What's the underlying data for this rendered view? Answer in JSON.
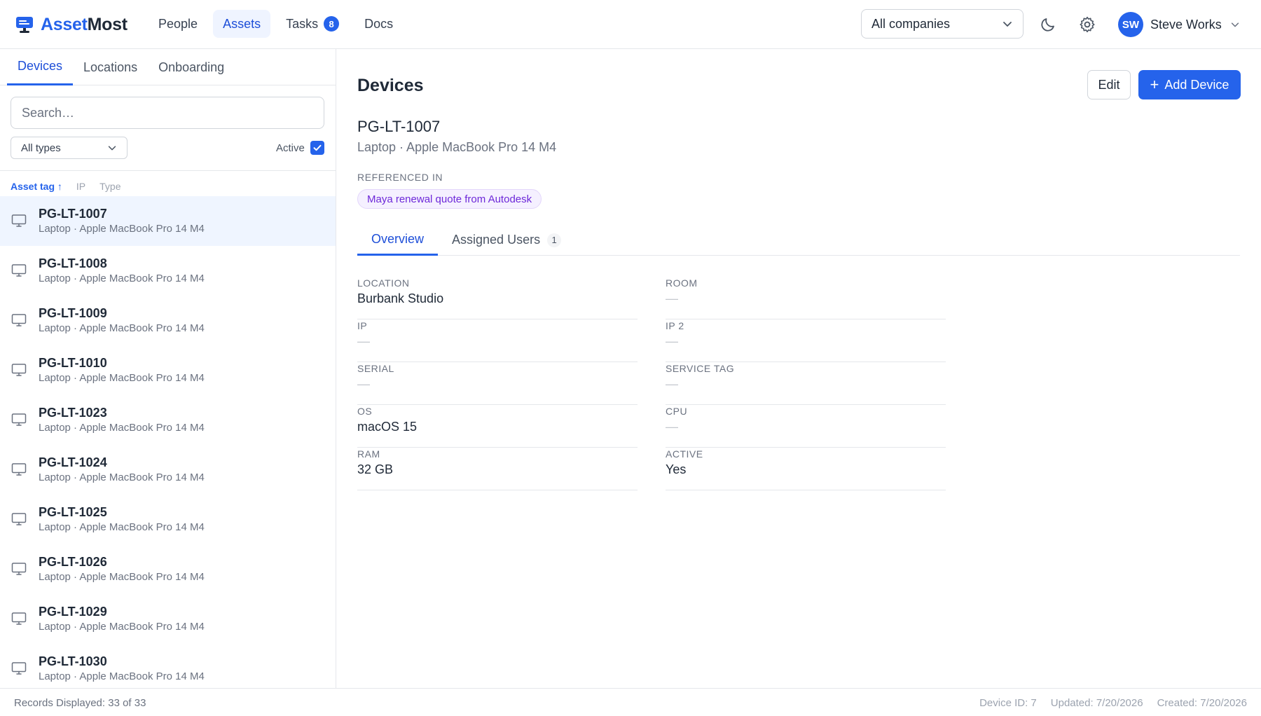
{
  "brand": {
    "name_part1": "Asset",
    "name_part2": "Most",
    "accent": "#2563eb"
  },
  "nav": {
    "items": [
      {
        "label": "People"
      },
      {
        "label": "Assets",
        "active": true
      },
      {
        "label": "Tasks",
        "badge": "8"
      },
      {
        "label": "Docs"
      }
    ]
  },
  "company_filter": {
    "value": "All companies"
  },
  "header_icons": [
    "moon-icon",
    "gear-icon"
  ],
  "user": {
    "initials": "SW",
    "name": "Steve Works"
  },
  "sidebar": {
    "tabs": [
      {
        "label": "Devices",
        "active": true
      },
      {
        "label": "Locations"
      },
      {
        "label": "Onboarding"
      }
    ],
    "search": {
      "placeholder": "Search…",
      "value": ""
    },
    "type_filter": {
      "value": "All types"
    },
    "active_filter": {
      "label": "Active",
      "checked": true
    },
    "sort_columns": [
      {
        "label": "Asset tag ↑",
        "active": true
      },
      {
        "label": "IP"
      },
      {
        "label": "Type"
      }
    ],
    "devices": [
      {
        "tag": "PG-LT-1007",
        "sub": "Laptop · Apple MacBook Pro 14 M4",
        "selected": true
      },
      {
        "tag": "PG-LT-1008",
        "sub": "Laptop · Apple MacBook Pro 14 M4"
      },
      {
        "tag": "PG-LT-1009",
        "sub": "Laptop · Apple MacBook Pro 14 M4"
      },
      {
        "tag": "PG-LT-1010",
        "sub": "Laptop · Apple MacBook Pro 14 M4"
      },
      {
        "tag": "PG-LT-1023",
        "sub": "Laptop · Apple MacBook Pro 14 M4"
      },
      {
        "tag": "PG-LT-1024",
        "sub": "Laptop · Apple MacBook Pro 14 M4"
      },
      {
        "tag": "PG-LT-1025",
        "sub": "Laptop · Apple MacBook Pro 14 M4"
      },
      {
        "tag": "PG-LT-1026",
        "sub": "Laptop · Apple MacBook Pro 14 M4"
      },
      {
        "tag": "PG-LT-1029",
        "sub": "Laptop · Apple MacBook Pro 14 M4"
      },
      {
        "tag": "PG-LT-1030",
        "sub": "Laptop · Apple MacBook Pro 14 M4"
      }
    ]
  },
  "main": {
    "title": "Devices",
    "edit_label": "Edit",
    "add_label": "Add Device",
    "device": {
      "tag": "PG-LT-1007",
      "subtitle": "Laptop · Apple MacBook Pro 14 M4",
      "referenced_label": "REFERENCED IN",
      "referenced_items": [
        "Maya renewal quote from Autodesk"
      ]
    },
    "tabs": [
      {
        "label": "Overview",
        "active": true
      },
      {
        "label": "Assigned Users",
        "count": "1"
      }
    ],
    "fields": [
      [
        {
          "label": "LOCATION",
          "value": "Burbank Studio"
        },
        {
          "label": "ROOM",
          "value": "—"
        }
      ],
      [
        {
          "label": "IP",
          "value": "—"
        },
        {
          "label": "IP 2",
          "value": "—"
        }
      ],
      [
        {
          "label": "SERIAL",
          "value": "—"
        },
        {
          "label": "SERVICE TAG",
          "value": "—"
        }
      ],
      [
        {
          "label": "OS",
          "value": "macOS 15"
        },
        {
          "label": "CPU",
          "value": "—"
        }
      ],
      [
        {
          "label": "RAM",
          "value": "32 GB"
        },
        {
          "label": "ACTIVE",
          "value": "Yes"
        }
      ]
    ]
  },
  "footer": {
    "records": "Records Displayed: 33 of 33",
    "device_id": "Device ID: 7",
    "updated": "Updated: 7/20/2026",
    "created": "Created: 7/20/2026"
  }
}
